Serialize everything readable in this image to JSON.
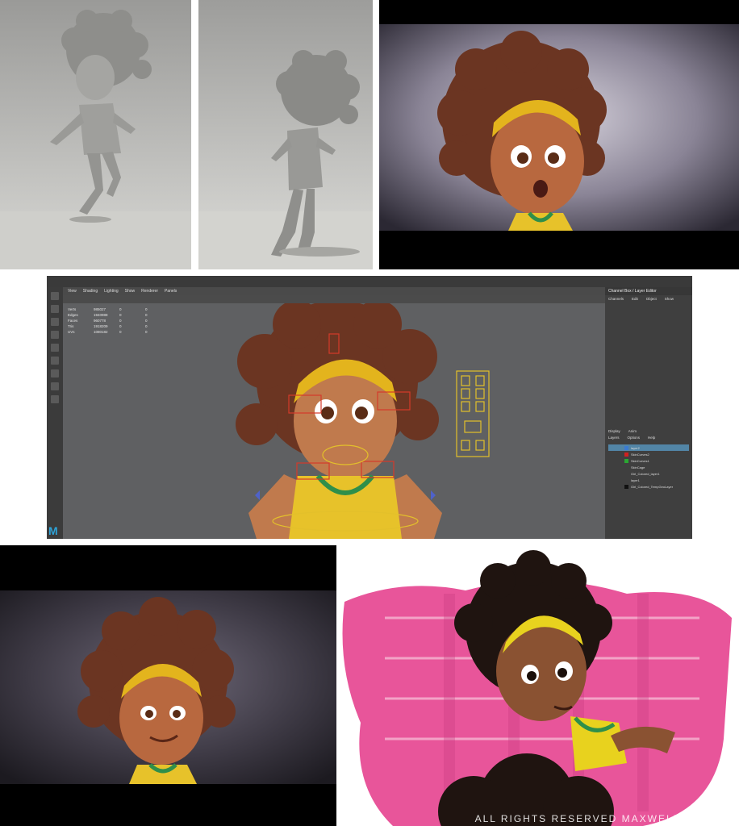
{
  "maya": {
    "menus": [
      "View",
      "Shading",
      "Lighting",
      "Show",
      "Renderer",
      "Panels"
    ],
    "hud": {
      "rows": [
        {
          "label": "Verts",
          "values": [
            "985027",
            "0",
            "0"
          ]
        },
        {
          "label": "Edges",
          "values": [
            "1940988",
            "0",
            "0"
          ]
        },
        {
          "label": "Faces",
          "values": [
            "960778",
            "0",
            "0"
          ]
        },
        {
          "label": "Tris",
          "values": [
            "1918209",
            "0",
            "0"
          ]
        },
        {
          "label": "UVs",
          "values": [
            "1080182",
            "0",
            "0"
          ]
        }
      ]
    },
    "channel_box": {
      "title": "Channel Box / Layer Editor",
      "tabs": [
        "Channels",
        "Edit",
        "Object",
        "Show"
      ]
    },
    "layer_editor": {
      "tabs": [
        "Display",
        "Anim"
      ],
      "menus": [
        "Layers",
        "Options",
        "Help"
      ],
      "layers": [
        {
          "name": "layer2",
          "selected": true,
          "color": "#3b7bd1"
        },
        {
          "name": "SkinCurves2",
          "selected": false,
          "color": "#d02020"
        },
        {
          "name": "SkinCurves1",
          "selected": false,
          "color": "#2aa832"
        },
        {
          "name": "SkinCage",
          "selected": false,
          "color": ""
        },
        {
          "name": "Girl_Colored_layer1",
          "selected": false,
          "color": ""
        },
        {
          "name": "layer1",
          "selected": false,
          "color": ""
        },
        {
          "name": "Girl_Colored_TempGeoLayer",
          "selected": false,
          "color": "#111111"
        }
      ]
    },
    "logo": "M"
  },
  "copyright": "ALL RIGHTS RESERVED MAXWELL EMCAYS",
  "colors": {
    "hair": "#6b3522",
    "skin": "#b8683f",
    "headband": "#e3b41d",
    "shirt": "#e7c22a",
    "collar": "#2f8f4a",
    "pink": "#e8559a"
  }
}
